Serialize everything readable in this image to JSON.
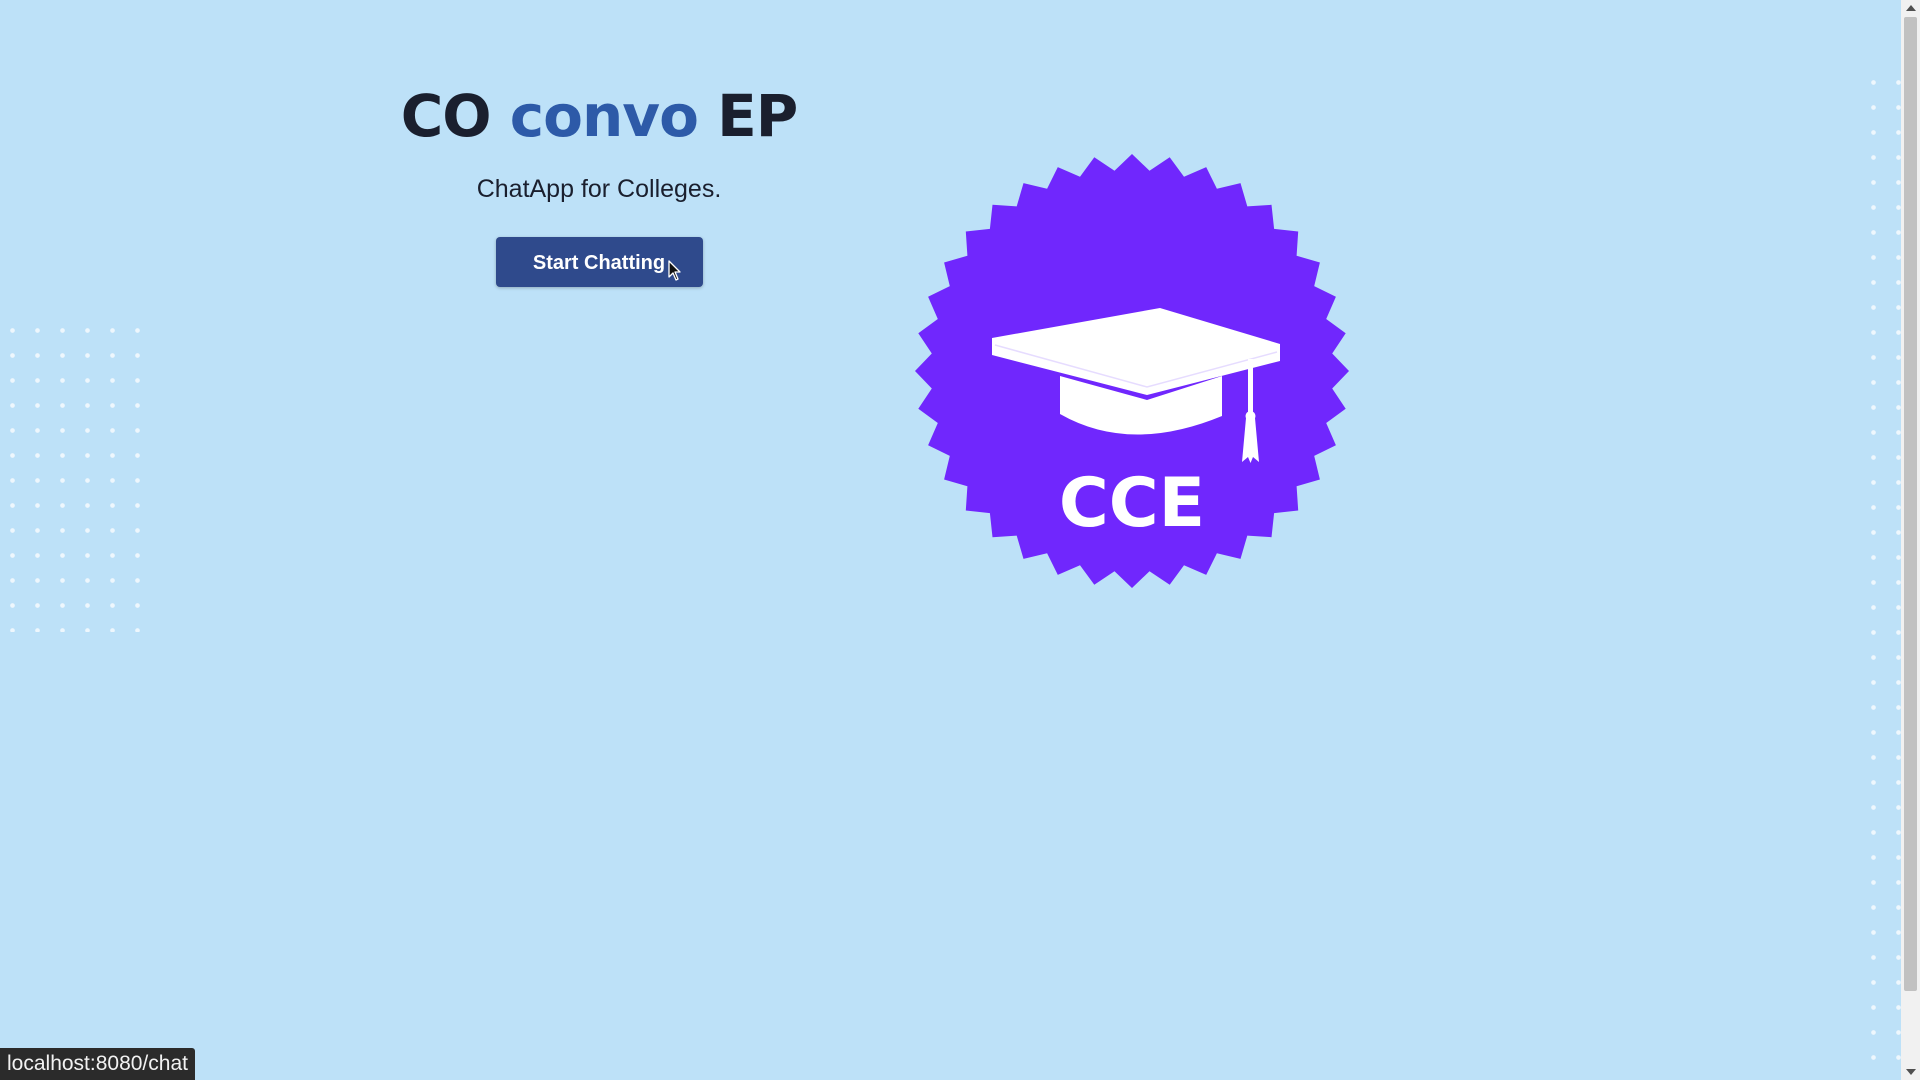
{
  "hero": {
    "title_part1": "CO",
    "title_accent": "convo",
    "title_part3": "EP",
    "subtitle": "ChatApp for Colleges.",
    "cta_label": "Start Chatting"
  },
  "badge": {
    "label": "CCE",
    "icon": "graduation-cap-icon",
    "color": "#7027fd"
  },
  "status_bar": {
    "url": "localhost:8080/chat"
  },
  "colors": {
    "background": "#bde1f8",
    "accent": "#2d5aa8",
    "button": "#2f4a8c",
    "text": "#1a1f2e"
  }
}
